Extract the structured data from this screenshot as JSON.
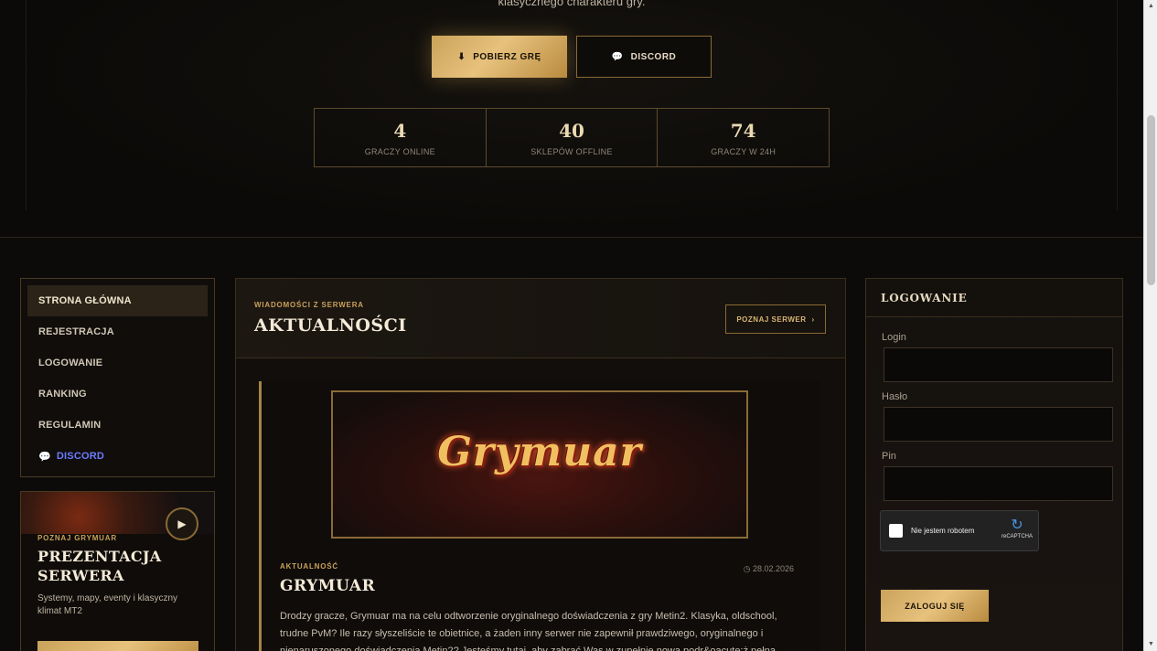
{
  "hero": {
    "subtitle": "klasycznego charakteru gry.",
    "download_label": "POBIERZ GRĘ",
    "discord_label": "DISCORD",
    "stats": [
      {
        "value": "4",
        "label": "GRACZY ONLINE"
      },
      {
        "value": "40",
        "label": "SKLEPÓW OFFLINE"
      },
      {
        "value": "74",
        "label": "GRACZY W 24H"
      }
    ]
  },
  "nav": {
    "items": [
      {
        "label": "STRONA GŁÓWNA"
      },
      {
        "label": "REJESTRACJA"
      },
      {
        "label": "LOGOWANIE"
      },
      {
        "label": "RANKING"
      },
      {
        "label": "REGULAMIN"
      },
      {
        "label": "DISCORD"
      }
    ]
  },
  "promo": {
    "kicker": "POZNAJ GRYMUAR",
    "title": "PREZENTACJA SERWERA",
    "description": "Systemy, mapy, eventy i klasyczny klimat MT2"
  },
  "news": {
    "kicker": "WIADOMOŚCI Z SERWERA",
    "title": "AKTUALNOŚCI",
    "button_label": "POZNAJ SERWER",
    "article": {
      "banner_text": "Grymuar",
      "kicker": "AKTUALNOŚĆ",
      "date": "28.02.2026",
      "title": "GRYMUAR",
      "body": "Drodzy gracze, Grymuar ma na celu odtworzenie oryginalnego doświadczenia z gry Metin2. Klasyka, oldschool, trudne PvM? Ile razy słyszeliście te obietnice, a żaden inny serwer nie zapewnił prawdziwego, oryginalnego i nienaruszonego doświadczenia Metin2? Jesteśmy tutaj, aby zabrać Was w zupełnie nową podr&oacute;ż pełną"
    }
  },
  "login": {
    "title": "LOGOWANIE",
    "login_label": "Login",
    "password_label": "Hasło",
    "pin_label": "Pin",
    "captcha_text": "Nie jestem robotem",
    "captcha_brand": "reCAPTCHA",
    "submit_label": "ZALOGUJ SIĘ"
  },
  "colors": {
    "gold": "#caa25a",
    "gold_light": "#e7c27d",
    "background": "#0d0b09",
    "discord": "#6b7cff"
  }
}
